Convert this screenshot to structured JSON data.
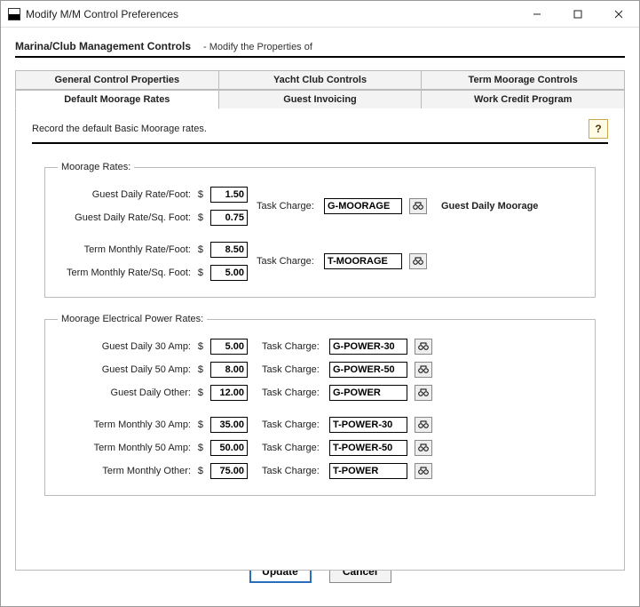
{
  "window": {
    "title": "Modify M/M Control Preferences"
  },
  "header": {
    "section": "Marina/Club Management Controls",
    "action": "- Modify the Properties of"
  },
  "tabs": {
    "row1": [
      "General Control Properties",
      "Yacht Club Controls",
      "Term Moorage Controls"
    ],
    "row2": [
      "Default Moorage Rates",
      "Guest Invoicing",
      "Work Credit Program"
    ],
    "active": "Default Moorage Rates"
  },
  "instruction": "Record the default Basic Moorage rates.",
  "help_icon": "?",
  "groups": {
    "moorage": {
      "legend": "Moorage Rates:",
      "task_charge_label": "Task Charge:",
      "guest_side_label": "Guest Daily Moorage",
      "rows": {
        "guest_foot": {
          "label": "Guest Daily Rate/Foot:",
          "currency": "$",
          "value": "1.50"
        },
        "guest_sqfoot": {
          "label": "Guest Daily Rate/Sq. Foot:",
          "currency": "$",
          "value": "0.75"
        },
        "term_foot": {
          "label": "Term Monthly Rate/Foot:",
          "currency": "$",
          "value": "8.50"
        },
        "term_sqfoot": {
          "label": "Term Monthly Rate/Sq. Foot:",
          "currency": "$",
          "value": "5.00"
        }
      },
      "charges": {
        "guest": "G-MOORAGE",
        "term": "T-MOORAGE"
      }
    },
    "power": {
      "legend": "Moorage Electrical Power Rates:",
      "task_charge_label": "Task Charge:",
      "rows": {
        "gd30": {
          "label": "Guest Daily 30 Amp:",
          "currency": "$",
          "value": "5.00",
          "charge": "G-POWER-30"
        },
        "gd50": {
          "label": "Guest Daily 50 Amp:",
          "currency": "$",
          "value": "8.00",
          "charge": "G-POWER-50"
        },
        "gdoth": {
          "label": "Guest Daily Other:",
          "currency": "$",
          "value": "12.00",
          "charge": "G-POWER"
        },
        "tm30": {
          "label": "Term Monthly 30 Amp:",
          "currency": "$",
          "value": "35.00",
          "charge": "T-POWER-30"
        },
        "tm50": {
          "label": "Term Monthly 50 Amp:",
          "currency": "$",
          "value": "50.00",
          "charge": "T-POWER-50"
        },
        "tmoth": {
          "label": "Term Monthly Other:",
          "currency": "$",
          "value": "75.00",
          "charge": "T-POWER"
        }
      }
    }
  },
  "buttons": {
    "update": "Update",
    "cancel": "Cancel"
  }
}
